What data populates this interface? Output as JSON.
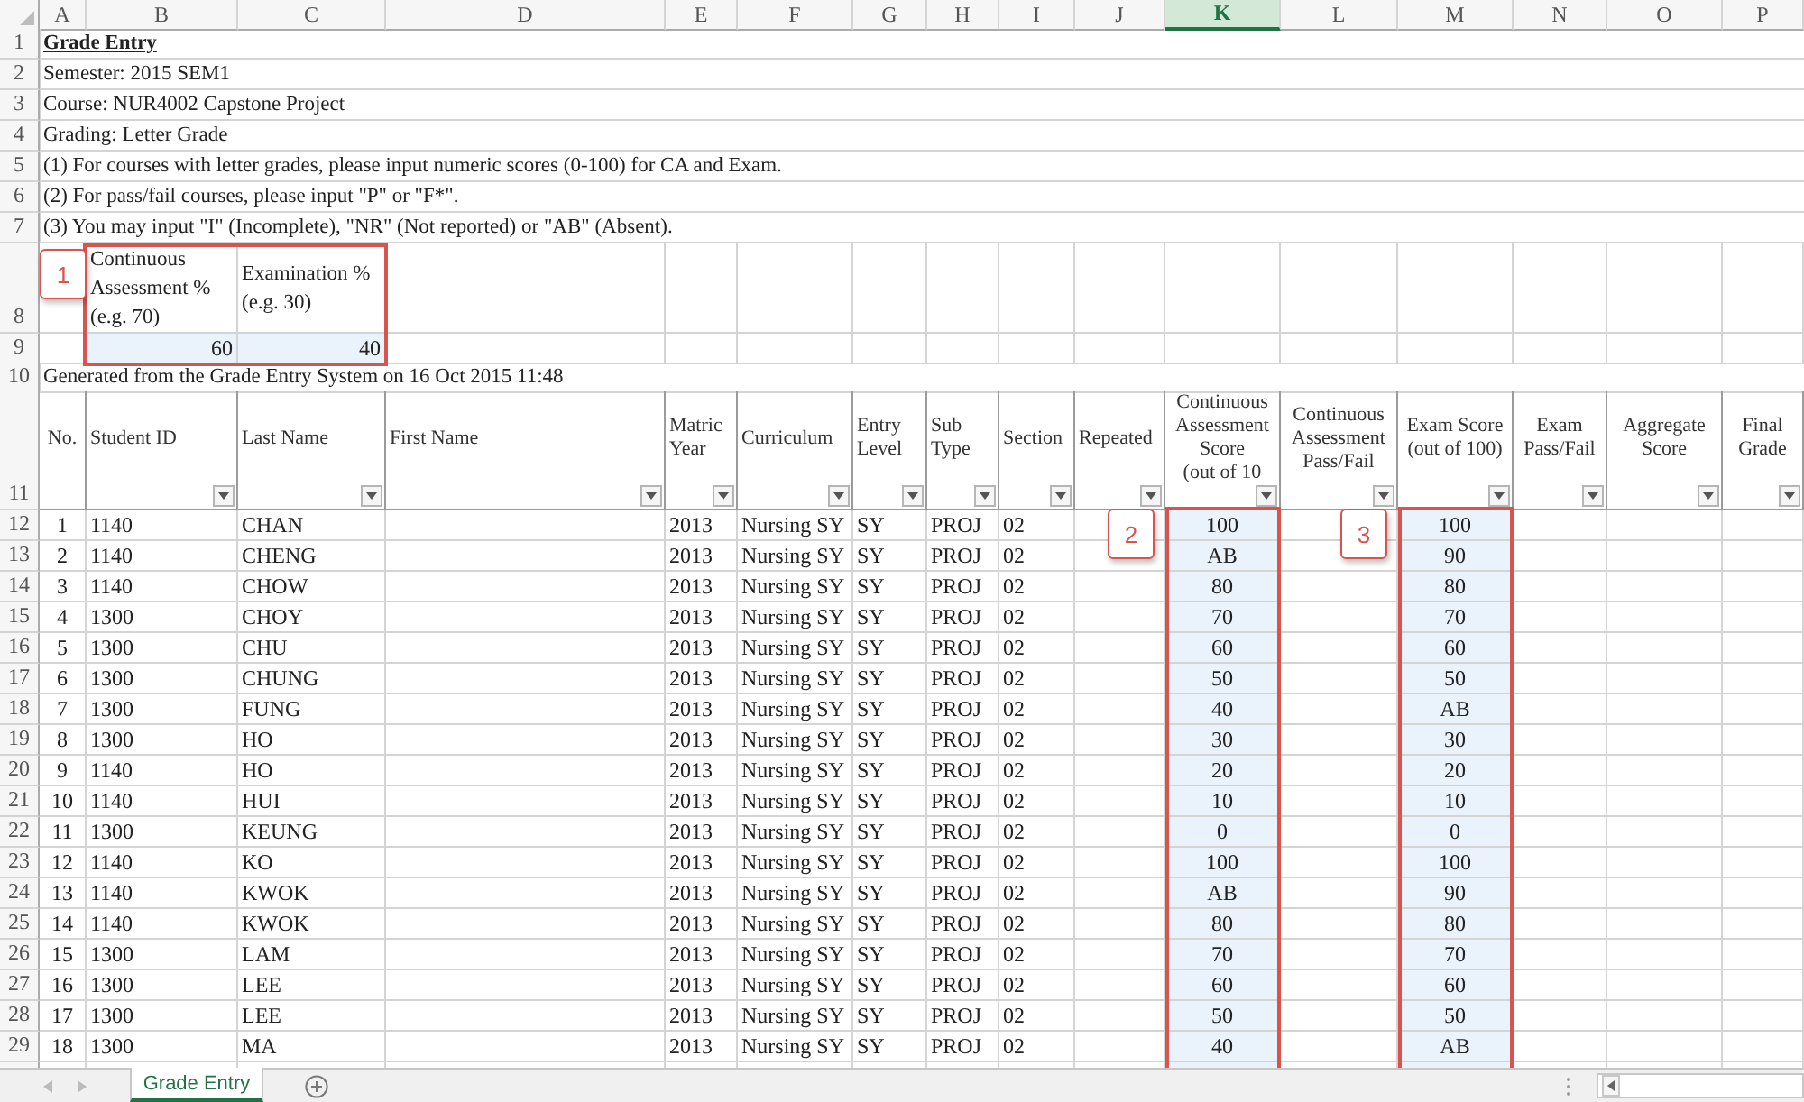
{
  "column_letters": [
    {
      "label": "A",
      "selected": false
    },
    {
      "label": "B",
      "selected": false
    },
    {
      "label": "C",
      "selected": false
    },
    {
      "label": "D",
      "selected": false
    },
    {
      "label": "E",
      "selected": false
    },
    {
      "label": "F",
      "selected": false
    },
    {
      "label": "G",
      "selected": false
    },
    {
      "label": "H",
      "selected": false
    },
    {
      "label": "I",
      "selected": false
    },
    {
      "label": "J",
      "selected": false
    },
    {
      "label": "K",
      "selected": true
    },
    {
      "label": "L",
      "selected": false
    },
    {
      "label": "M",
      "selected": false
    },
    {
      "label": "N",
      "selected": false
    },
    {
      "label": "O",
      "selected": false
    },
    {
      "label": "P",
      "selected": false
    }
  ],
  "title": {
    "row": "1",
    "text": "Grade Entry"
  },
  "info_lines": [
    {
      "row": "2",
      "text": "Semester: 2015 SEM1"
    },
    {
      "row": "3",
      "text": "Course: NUR4002 Capstone Project"
    },
    {
      "row": "4",
      "text": "Grading: Letter Grade"
    },
    {
      "row": "5",
      "text": "(1) For courses with letter grades, please input numeric scores (0-100) for CA and Exam."
    },
    {
      "row": "6",
      "text": "(2) For pass/fail courses, please input \"P\" or \"F*\"."
    },
    {
      "row": "7",
      "text": "(3) You may input \"I\" (Incomplete), \"NR\" (Not reported) or \"AB\" (Absent)."
    }
  ],
  "weights": {
    "header_row": "8",
    "value_row": "9",
    "headers": [
      "Continuous\nAssessment %\n(e.g. 70)",
      "Examination %\n(e.g. 30)"
    ],
    "values": [
      "60",
      "40"
    ]
  },
  "generated": {
    "row": "10",
    "text": "Generated from the Grade Entry System on 16 Oct 2015 11:48"
  },
  "table": {
    "header_row": "11",
    "columns": [
      {
        "label": "No.",
        "filter": false,
        "highlighted": false
      },
      {
        "label": "Student ID",
        "filter": true,
        "highlighted": false
      },
      {
        "label": "Last Name",
        "filter": true,
        "highlighted": false
      },
      {
        "label": "First Name",
        "filter": true,
        "highlighted": false
      },
      {
        "label": "Matric\nYear",
        "filter": true,
        "highlighted": false
      },
      {
        "label": "Curriculum",
        "filter": true,
        "highlighted": false
      },
      {
        "label": "Entry\nLevel",
        "filter": true,
        "highlighted": false
      },
      {
        "label": "Sub\nType",
        "filter": true,
        "highlighted": false
      },
      {
        "label": "Section",
        "filter": true,
        "highlighted": false
      },
      {
        "label": "Repeated",
        "filter": true,
        "highlighted": false
      },
      {
        "label": "Continuous\nAssessment\nScore\n(out of 10",
        "filter": true,
        "highlighted": true
      },
      {
        "label": "Continuous\nAssessment\nPass/Fail",
        "filter": true,
        "highlighted": false
      },
      {
        "label": "Exam Score\n(out of 100)",
        "filter": true,
        "highlighted": true
      },
      {
        "label": "Exam\nPass/Fail",
        "filter": true,
        "highlighted": false
      },
      {
        "label": "Aggregate\nScore",
        "filter": true,
        "highlighted": false
      },
      {
        "label": "Final\nGrade",
        "filter": true,
        "highlighted": false
      }
    ],
    "rows": [
      {
        "row": "12",
        "no": "1",
        "student_id": "1140",
        "last_name": "CHAN",
        "matric_year": "2013",
        "curriculum": "Nursing SY",
        "entry_level": "SY",
        "sub_type": "PROJ",
        "section": "02",
        "ca_score": "100",
        "exam_score": "100"
      },
      {
        "row": "13",
        "no": "2",
        "student_id": "1140",
        "last_name": "CHENG",
        "matric_year": "2013",
        "curriculum": "Nursing SY",
        "entry_level": "SY",
        "sub_type": "PROJ",
        "section": "02",
        "ca_score": "AB",
        "exam_score": "90"
      },
      {
        "row": "14",
        "no": "3",
        "student_id": "1140",
        "last_name": "CHOW",
        "matric_year": "2013",
        "curriculum": "Nursing SY",
        "entry_level": "SY",
        "sub_type": "PROJ",
        "section": "02",
        "ca_score": "80",
        "exam_score": "80"
      },
      {
        "row": "15",
        "no": "4",
        "student_id": "1300",
        "last_name": "CHOY",
        "matric_year": "2013",
        "curriculum": "Nursing SY",
        "entry_level": "SY",
        "sub_type": "PROJ",
        "section": "02",
        "ca_score": "70",
        "exam_score": "70"
      },
      {
        "row": "16",
        "no": "5",
        "student_id": "1300",
        "last_name": "CHU",
        "matric_year": "2013",
        "curriculum": "Nursing SY",
        "entry_level": "SY",
        "sub_type": "PROJ",
        "section": "02",
        "ca_score": "60",
        "exam_score": "60"
      },
      {
        "row": "17",
        "no": "6",
        "student_id": "1300",
        "last_name": "CHUNG",
        "matric_year": "2013",
        "curriculum": "Nursing SY",
        "entry_level": "SY",
        "sub_type": "PROJ",
        "section": "02",
        "ca_score": "50",
        "exam_score": "50"
      },
      {
        "row": "18",
        "no": "7",
        "student_id": "1300",
        "last_name": "FUNG",
        "matric_year": "2013",
        "curriculum": "Nursing SY",
        "entry_level": "SY",
        "sub_type": "PROJ",
        "section": "02",
        "ca_score": "40",
        "exam_score": "AB"
      },
      {
        "row": "19",
        "no": "8",
        "student_id": "1300",
        "last_name": "HO",
        "matric_year": "2013",
        "curriculum": "Nursing SY",
        "entry_level": "SY",
        "sub_type": "PROJ",
        "section": "02",
        "ca_score": "30",
        "exam_score": "30"
      },
      {
        "row": "20",
        "no": "9",
        "student_id": "1140",
        "last_name": "HO",
        "matric_year": "2013",
        "curriculum": "Nursing SY",
        "entry_level": "SY",
        "sub_type": "PROJ",
        "section": "02",
        "ca_score": "20",
        "exam_score": "20"
      },
      {
        "row": "21",
        "no": "10",
        "student_id": "1140",
        "last_name": "HUI",
        "matric_year": "2013",
        "curriculum": "Nursing SY",
        "entry_level": "SY",
        "sub_type": "PROJ",
        "section": "02",
        "ca_score": "10",
        "exam_score": "10"
      },
      {
        "row": "22",
        "no": "11",
        "student_id": "1300",
        "last_name": "KEUNG",
        "matric_year": "2013",
        "curriculum": "Nursing SY",
        "entry_level": "SY",
        "sub_type": "PROJ",
        "section": "02",
        "ca_score": "0",
        "exam_score": "0"
      },
      {
        "row": "23",
        "no": "12",
        "student_id": "1140",
        "last_name": "KO",
        "matric_year": "2013",
        "curriculum": "Nursing SY",
        "entry_level": "SY",
        "sub_type": "PROJ",
        "section": "02",
        "ca_score": "100",
        "exam_score": "100"
      },
      {
        "row": "24",
        "no": "13",
        "student_id": "1140",
        "last_name": "KWOK",
        "matric_year": "2013",
        "curriculum": "Nursing SY",
        "entry_level": "SY",
        "sub_type": "PROJ",
        "section": "02",
        "ca_score": "AB",
        "exam_score": "90"
      },
      {
        "row": "25",
        "no": "14",
        "student_id": "1140",
        "last_name": "KWOK",
        "matric_year": "2013",
        "curriculum": "Nursing SY",
        "entry_level": "SY",
        "sub_type": "PROJ",
        "section": "02",
        "ca_score": "80",
        "exam_score": "80"
      },
      {
        "row": "26",
        "no": "15",
        "student_id": "1300",
        "last_name": "LAM",
        "matric_year": "2013",
        "curriculum": "Nursing SY",
        "entry_level": "SY",
        "sub_type": "PROJ",
        "section": "02",
        "ca_score": "70",
        "exam_score": "70"
      },
      {
        "row": "27",
        "no": "16",
        "student_id": "1300",
        "last_name": "LEE",
        "matric_year": "2013",
        "curriculum": "Nursing SY",
        "entry_level": "SY",
        "sub_type": "PROJ",
        "section": "02",
        "ca_score": "60",
        "exam_score": "60"
      },
      {
        "row": "28",
        "no": "17",
        "student_id": "1300",
        "last_name": "LEE",
        "matric_year": "2013",
        "curriculum": "Nursing SY",
        "entry_level": "SY",
        "sub_type": "PROJ",
        "section": "02",
        "ca_score": "50",
        "exam_score": "50"
      },
      {
        "row": "29",
        "no": "18",
        "student_id": "1300",
        "last_name": "MA",
        "matric_year": "2013",
        "curriculum": "Nursing SY",
        "entry_level": "SY",
        "sub_type": "PROJ",
        "section": "02",
        "ca_score": "40",
        "exam_score": "AB"
      }
    ]
  },
  "callouts": [
    "1",
    "2",
    "3"
  ],
  "sheet_tabs": [
    {
      "label": "Grade Entry",
      "selected": true
    }
  ]
}
